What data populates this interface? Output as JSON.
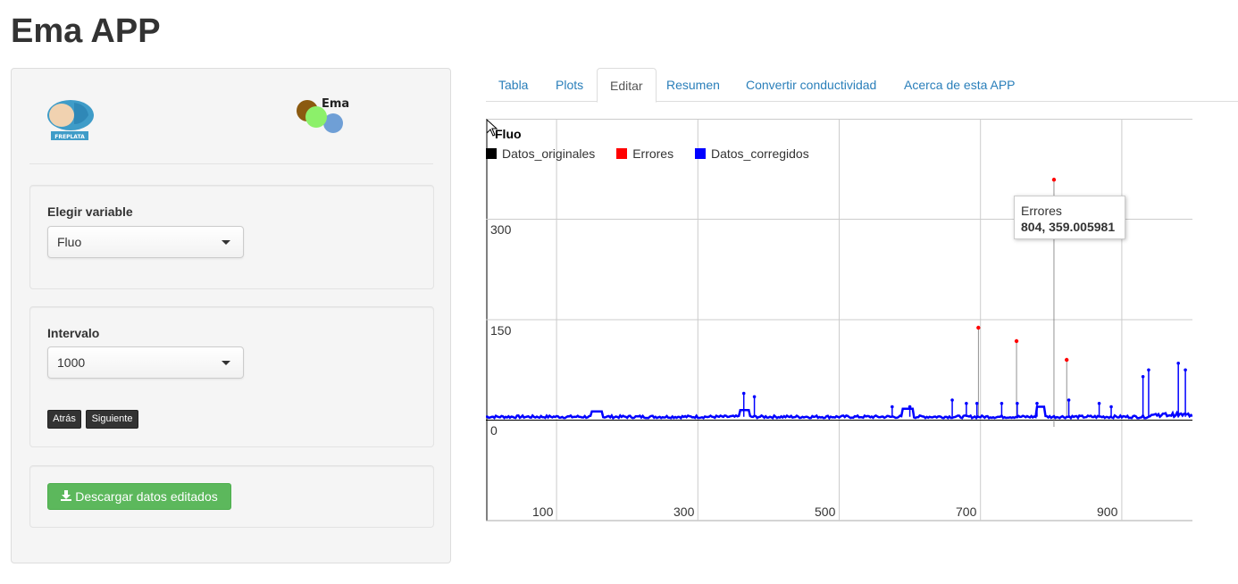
{
  "app": {
    "title": "Ema APP"
  },
  "sidebar": {
    "logos": {
      "freplata_text": "FREPLATA",
      "ema_text": "Ema"
    },
    "variable": {
      "label": "Elegir variable",
      "selected": "Fluo"
    },
    "interval": {
      "label": "Intervalo",
      "selected": "1000",
      "prev_label": "Atrás",
      "next_label": "Siguiente"
    },
    "download": {
      "label": "Descargar datos editados",
      "icon": "download-icon"
    }
  },
  "tabs": [
    {
      "label": "Tabla",
      "active": false
    },
    {
      "label": "Plots",
      "active": false
    },
    {
      "label": "Editar",
      "active": true
    },
    {
      "label": "Resumen",
      "active": false
    },
    {
      "label": "Convertir conductividad",
      "active": false
    },
    {
      "label": "Acerca de esta APP",
      "active": false
    }
  ],
  "colors": {
    "originales": "#000000",
    "errores": "#ff0000",
    "corregidos": "#0000ff",
    "accent_link": "#2a7fba",
    "download_green": "#5cb85c"
  },
  "chart_data": {
    "type": "line",
    "title": "Fluo",
    "legend_position": "top-left",
    "grid": true,
    "series": [
      {
        "name": "Datos_originales",
        "color": "#000000"
      },
      {
        "name": "Errores",
        "color": "#ff0000"
      },
      {
        "name": "Datos_corregidos",
        "color": "#0000ff"
      }
    ],
    "x_ticks": [
      "100",
      "300",
      "500",
      "700",
      "900"
    ],
    "y_ticks": [
      "0",
      "150",
      "300"
    ],
    "xlim": [
      0,
      1000
    ],
    "ylim": [
      -150,
      450
    ],
    "baseline": 5,
    "corrected_spikes": [
      {
        "x": 365,
        "y": 40
      },
      {
        "x": 380,
        "y": 35
      },
      {
        "x": 575,
        "y": 20
      },
      {
        "x": 600,
        "y": 20
      },
      {
        "x": 660,
        "y": 30
      },
      {
        "x": 680,
        "y": 25
      },
      {
        "x": 695,
        "y": 25
      },
      {
        "x": 730,
        "y": 25
      },
      {
        "x": 752,
        "y": 25
      },
      {
        "x": 780,
        "y": 25
      },
      {
        "x": 825,
        "y": 30
      },
      {
        "x": 868,
        "y": 25
      },
      {
        "x": 885,
        "y": 20
      },
      {
        "x": 930,
        "y": 65
      },
      {
        "x": 938,
        "y": 75
      },
      {
        "x": 980,
        "y": 85
      },
      {
        "x": 990,
        "y": 75
      }
    ],
    "errores": [
      {
        "x": 697,
        "y": 138
      },
      {
        "x": 751,
        "y": 118
      },
      {
        "x": 804,
        "y": 359.005981
      },
      {
        "x": 822,
        "y": 90
      }
    ],
    "tooltip": {
      "series": "Errores",
      "value": "804, 359.005981"
    }
  }
}
